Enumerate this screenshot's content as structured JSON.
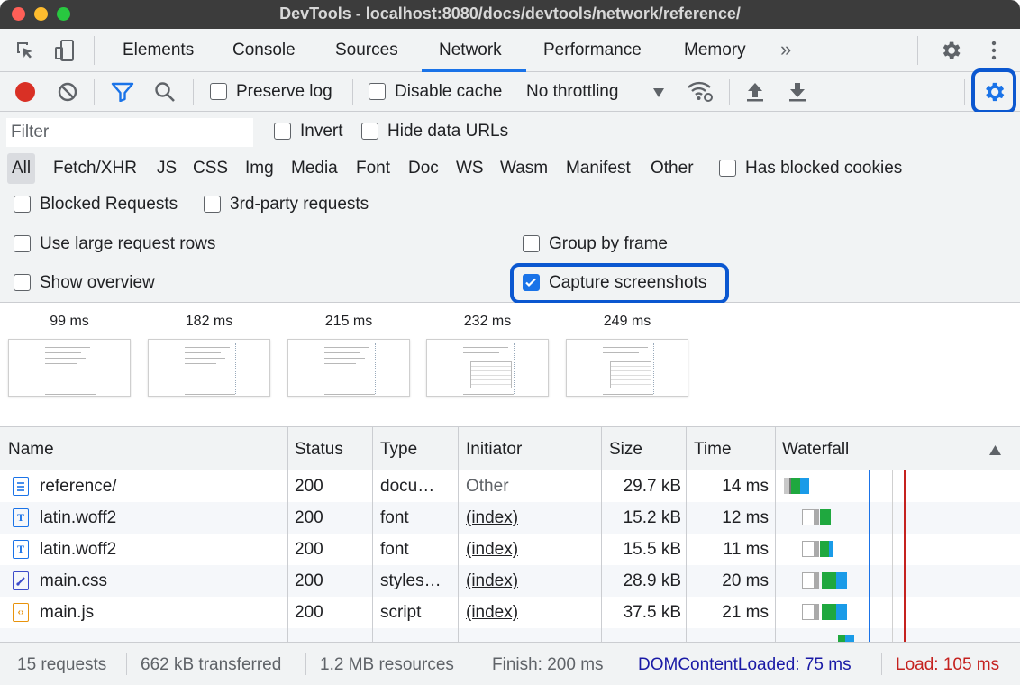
{
  "window": {
    "title": "DevTools - localhost:8080/docs/devtools/network/reference/"
  },
  "tabs": [
    "Elements",
    "Console",
    "Sources",
    "Network",
    "Performance",
    "Memory"
  ],
  "active_tab": "Network",
  "toolbar": {
    "preserve_log": "Preserve log",
    "disable_cache": "Disable cache",
    "throttling": "No throttling"
  },
  "filter": {
    "placeholder": "Filter",
    "invert": "Invert",
    "hide_data_urls": "Hide data URLs",
    "types": [
      "All",
      "Fetch/XHR",
      "JS",
      "CSS",
      "Img",
      "Media",
      "Font",
      "Doc",
      "WS",
      "Wasm",
      "Manifest",
      "Other"
    ],
    "has_blocked_cookies": "Has blocked cookies",
    "blocked_requests": "Blocked Requests",
    "third_party": "3rd-party requests"
  },
  "settings": {
    "large_rows": "Use large request rows",
    "group_by_frame": "Group by frame",
    "show_overview": "Show overview",
    "capture_screenshots": "Capture screenshots",
    "capture_screenshots_checked": true
  },
  "filmstrip": [
    "99 ms",
    "182 ms",
    "215 ms",
    "232 ms",
    "249 ms"
  ],
  "table": {
    "headers": [
      "Name",
      "Status",
      "Type",
      "Initiator",
      "Size",
      "Time",
      "Waterfall"
    ],
    "rows": [
      {
        "name": "reference/",
        "status": "200",
        "type": "docu…",
        "initiator": "Other",
        "size": "29.7 kB",
        "time": "14 ms",
        "icon": "document-icon"
      },
      {
        "name": "latin.woff2",
        "status": "200",
        "type": "font",
        "initiator": "(index)",
        "size": "15.2 kB",
        "time": "12 ms",
        "icon": "font-icon"
      },
      {
        "name": "latin.woff2",
        "status": "200",
        "type": "font",
        "initiator": "(index)",
        "size": "15.5 kB",
        "time": "11 ms",
        "icon": "font-icon"
      },
      {
        "name": "main.css",
        "status": "200",
        "type": "styles…",
        "initiator": "(index)",
        "size": "28.9 kB",
        "time": "20 ms",
        "icon": "stylesheet-icon"
      },
      {
        "name": "main.js",
        "status": "200",
        "type": "script",
        "initiator": "(index)",
        "size": "37.5 kB",
        "time": "21 ms",
        "icon": "script-icon"
      }
    ]
  },
  "status": {
    "requests": "15 requests",
    "transferred": "662 kB transferred",
    "resources": "1.2 MB resources",
    "finish": "Finish: 200 ms",
    "dcl": "DOMContentLoaded: 75 ms",
    "load": "Load: 105 ms"
  },
  "colors": {
    "accent": "#1a73e8",
    "highlight": "#0b57d0",
    "dcl": "#1a1aa6",
    "load": "#c5221f"
  }
}
